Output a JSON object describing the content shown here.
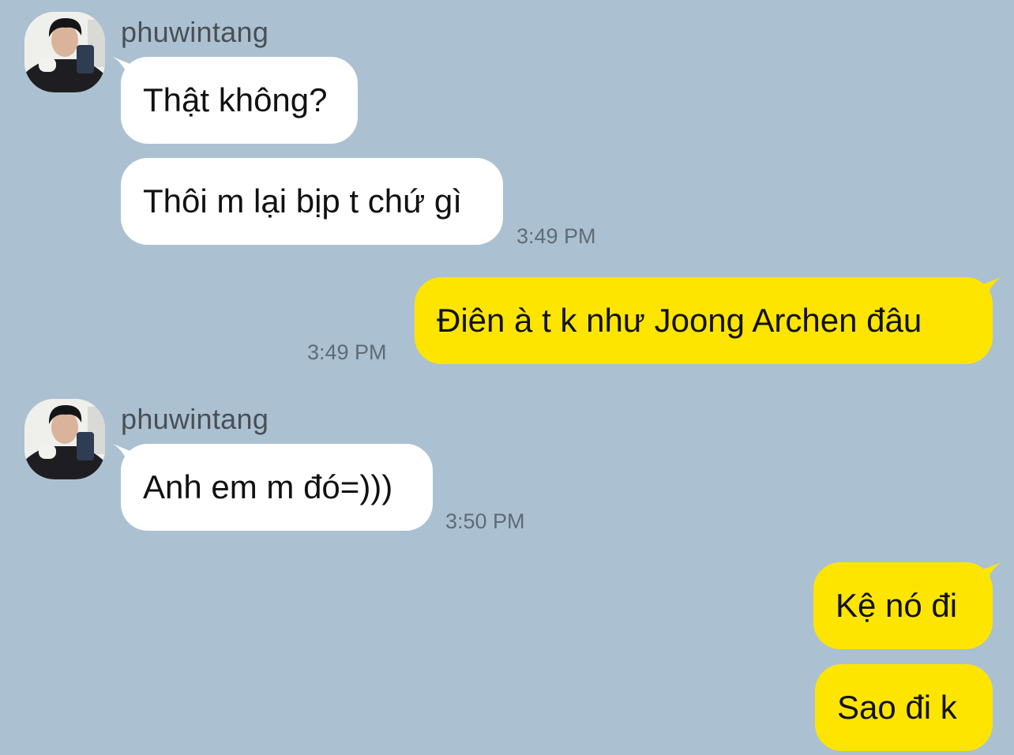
{
  "chat": {
    "groups": [
      {
        "sender": "phuwintang",
        "messages": [
          "Thật không?",
          "Thôi m lại bịp t chứ gì"
        ],
        "time": "3:49 PM"
      },
      {
        "self_message": "Điên à t k như Joong Archen đâu",
        "time": "3:49 PM"
      },
      {
        "sender": "phuwintang",
        "messages": [
          "Anh em m đó=)))"
        ],
        "time": "3:50 PM"
      },
      {
        "self_messages": [
          "Kệ nó đi",
          "Sao đi k"
        ]
      }
    ]
  },
  "colors": {
    "background": "#abc1d1",
    "incoming_bubble": "#ffffff",
    "outgoing_bubble": "#fee500"
  },
  "icons": {
    "avatar": "profile-photo"
  }
}
